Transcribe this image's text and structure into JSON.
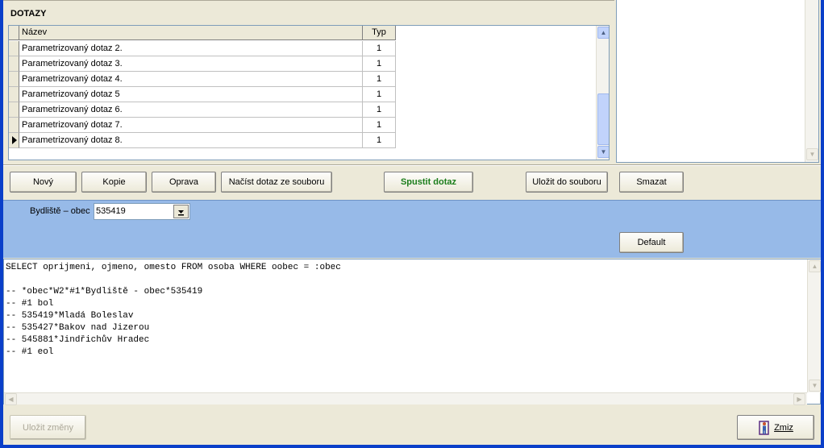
{
  "section_title": "DOTAZY",
  "grid": {
    "columns": [
      "Název",
      "Typ"
    ],
    "rows": [
      {
        "name": "Parametrizovaný dotaz 2.",
        "typ": "1"
      },
      {
        "name": "Parametrizovaný dotaz 3.",
        "typ": "1"
      },
      {
        "name": "Parametrizovaný dotaz 4.",
        "typ": "1"
      },
      {
        "name": "Parametrizovaný dotaz 5",
        "typ": "1"
      },
      {
        "name": "Parametrizovaný dotaz 6.",
        "typ": "1"
      },
      {
        "name": "Parametrizovaný dotaz 7.",
        "typ": "1"
      },
      {
        "name": "Parametrizovaný dotaz 8.",
        "typ": "1"
      }
    ]
  },
  "buttons": {
    "novy": "Nový",
    "kopie": "Kopie",
    "oprava": "Oprava",
    "nacist": "Načíst dotaz ze souboru",
    "spustit": "Spustit dotaz",
    "ulozit_soubor": "Uložit do souboru",
    "smazat": "Smazat",
    "default": "Default",
    "ulozit_zmeny": "Uložit změny",
    "zmiz": "Zmiz"
  },
  "param": {
    "label": "Bydliště – obec",
    "value": "535419"
  },
  "sql_lines": [
    "SELECT oprijmeni, ojmeno, omesto FROM osoba WHERE oobec = :obec",
    "",
    "-- *obec*W2*#1*Bydliště - obec*535419",
    "-- #1 bol",
    "-- 535419*Mladá Boleslav",
    "-- 535427*Bakov nad Jizerou",
    "-- 545881*Jindřichův Hradec",
    "-- #1 eol"
  ],
  "colors": {
    "window_frame": "#0a3fc9",
    "param_panel": "#97bae8",
    "run_button_text": "#1b7d1b"
  }
}
